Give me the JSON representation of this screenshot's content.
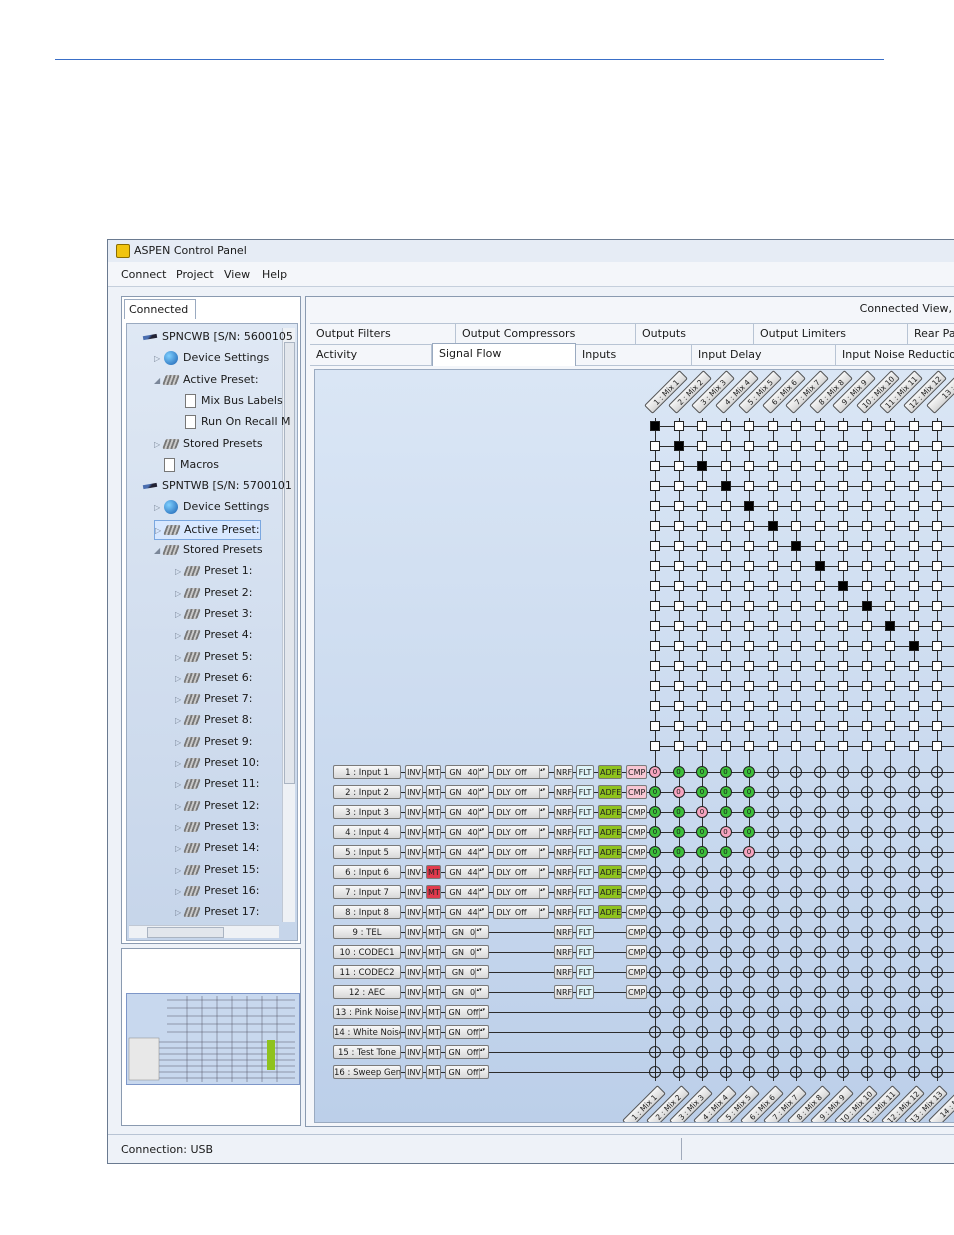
{
  "window": {
    "title": "ASPEN Control Panel"
  },
  "menu": [
    "Connect",
    "Project",
    "View",
    "Help"
  ],
  "left": {
    "tab": "Connected",
    "tree": [
      {
        "label": "SPNCWB [S/N: 5600105",
        "icon": "pen-icon",
        "level": 0,
        "arrow": ""
      },
      {
        "label": "Device Settings",
        "icon": "globe-icon",
        "level": 1,
        "arrow": "▷"
      },
      {
        "label": "Active Preset:",
        "icon": "chip-icon",
        "level": 1,
        "arrow": "◢"
      },
      {
        "label": "Mix Bus Labels",
        "icon": "document-icon",
        "level": 2,
        "arrow": ""
      },
      {
        "label": "Run On Recall M",
        "icon": "document-icon",
        "level": 2,
        "arrow": ""
      },
      {
        "label": "Stored Presets",
        "icon": "chip-icon",
        "level": 1,
        "arrow": "▷"
      },
      {
        "label": "Macros",
        "icon": "document-icon",
        "level": 1,
        "arrow": ""
      },
      {
        "label": "SPNTWB [S/N: 5700101",
        "icon": "pen-icon",
        "level": 0,
        "arrow": ""
      },
      {
        "label": "Device Settings",
        "icon": "globe-icon",
        "level": 1,
        "arrow": "▷"
      },
      {
        "label": "Active Preset:",
        "icon": "chip-icon",
        "level": 1,
        "arrow": "▷",
        "selected": true
      },
      {
        "label": "Stored Presets",
        "icon": "chip-icon",
        "level": 1,
        "arrow": "◢"
      },
      {
        "label": "Preset 1:",
        "icon": "chip-icon",
        "level": 2,
        "arrow": "▷"
      },
      {
        "label": "Preset 2:",
        "icon": "chip-icon",
        "level": 2,
        "arrow": "▷"
      },
      {
        "label": "Preset 3:",
        "icon": "chip-icon",
        "level": 2,
        "arrow": "▷"
      },
      {
        "label": "Preset 4:",
        "icon": "chip-icon",
        "level": 2,
        "arrow": "▷"
      },
      {
        "label": "Preset 5:",
        "icon": "chip-icon",
        "level": 2,
        "arrow": "▷"
      },
      {
        "label": "Preset 6:",
        "icon": "chip-icon",
        "level": 2,
        "arrow": "▷"
      },
      {
        "label": "Preset 7:",
        "icon": "chip-icon",
        "level": 2,
        "arrow": "▷"
      },
      {
        "label": "Preset 8:",
        "icon": "chip-icon",
        "level": 2,
        "arrow": "▷"
      },
      {
        "label": "Preset 9:",
        "icon": "chip-icon",
        "level": 2,
        "arrow": "▷"
      },
      {
        "label": "Preset 10:",
        "icon": "chip-icon",
        "level": 2,
        "arrow": "▷"
      },
      {
        "label": "Preset 11:",
        "icon": "chip-icon",
        "level": 2,
        "arrow": "▷"
      },
      {
        "label": "Preset 12:",
        "icon": "chip-icon",
        "level": 2,
        "arrow": "▷"
      },
      {
        "label": "Preset 13:",
        "icon": "chip-icon",
        "level": 2,
        "arrow": "▷"
      },
      {
        "label": "Preset 14:",
        "icon": "chip-icon",
        "level": 2,
        "arrow": "▷"
      },
      {
        "label": "Preset 15:",
        "icon": "chip-icon",
        "level": 2,
        "arrow": "▷"
      },
      {
        "label": "Preset 16:",
        "icon": "chip-icon",
        "level": 2,
        "arrow": "▷"
      },
      {
        "label": "Preset 17:",
        "icon": "chip-icon",
        "level": 2,
        "arrow": "▷"
      }
    ]
  },
  "right": {
    "header": "Connected View,",
    "tabs_row1": [
      "Output Filters",
      "Output Compressors",
      "Outputs",
      "Output Limiters",
      "Rear Pa"
    ],
    "tabs_row2": [
      "Activity",
      "Signal Flow",
      "Inputs",
      "Input Delay",
      "Input Noise Reduction"
    ],
    "active_tab": "Signal Flow"
  },
  "signal_flow": {
    "mix_labels_top": [
      "1 : Mix 1",
      "2 : Mix 2",
      "3 : Mix 3",
      "4 : Mix 4",
      "5 : Mix 5",
      "6 : Mix 6",
      "7 : Mix 7",
      "8 : Mix 8",
      "9 : Mix 9",
      "10 : Mix 10",
      "11 : Mix 11",
      "12 : Mix 12",
      "13 :"
    ],
    "mix_labels_bottom": [
      "1 : Mix 1",
      "2 : Mix 2",
      "3 : Mix 3",
      "4 : Mix 4",
      "5 : Mix 5",
      "6 : Mix 6",
      "7 : Mix 7",
      "8 : Mix 8",
      "9 : Mix 9",
      "10 : Mix 10",
      "11 : Mix 11",
      "12 : Mix 12",
      "13 : Mix 13",
      "14 : Mi"
    ],
    "inputs": [
      {
        "name": "1 : Input 1",
        "gain": "40",
        "delay": "Off",
        "mute": false,
        "adfe": true,
        "cmp": "pink",
        "nodes": "P0G0G0G0G0"
      },
      {
        "name": "2 : Input 2",
        "gain": "40",
        "delay": "Off",
        "mute": false,
        "adfe": true,
        "cmp": "pink",
        "nodes": "G0P0G0G0G0"
      },
      {
        "name": "3 : Input 3",
        "gain": "40",
        "delay": "Off",
        "mute": false,
        "adfe": true,
        "cmp": "",
        "nodes": "G0G0P0G0G0"
      },
      {
        "name": "4 : Input 4",
        "gain": "40",
        "delay": "Off",
        "mute": false,
        "adfe": true,
        "cmp": "",
        "nodes": "G0G0G0P0G0"
      },
      {
        "name": "5 : Input 5",
        "gain": "44",
        "delay": "Off",
        "mute": false,
        "adfe": true,
        "cmp": "",
        "nodes": "G0G0G0G0P0"
      },
      {
        "name": "6 : Input 6",
        "gain": "44",
        "delay": "Off",
        "mute": true,
        "adfe": true,
        "cmp": "",
        "nodes": ""
      },
      {
        "name": "7 : Input 7",
        "gain": "44",
        "delay": "Off",
        "mute": true,
        "adfe": true,
        "cmp": "",
        "nodes": ""
      },
      {
        "name": "8 : Input 8",
        "gain": "44",
        "delay": "Off",
        "mute": false,
        "adfe": true,
        "cmp": "",
        "nodes": ""
      },
      {
        "name": "9 : TEL",
        "gain": "0",
        "delay": "",
        "mute": false,
        "adfe": false,
        "cmp": "",
        "nodes": ""
      },
      {
        "name": "10 : CODEC1",
        "gain": "0",
        "delay": "",
        "mute": false,
        "adfe": false,
        "cmp": "",
        "nodes": ""
      },
      {
        "name": "11 : CODEC2",
        "gain": "0",
        "delay": "",
        "mute": false,
        "adfe": false,
        "cmp": "",
        "nodes": ""
      },
      {
        "name": "12 : AEC",
        "gain": "0",
        "delay": "",
        "mute": false,
        "adfe": false,
        "cmp": "",
        "nodes": ""
      },
      {
        "name": "13 : Pink Noise",
        "gain": "Off",
        "delay": "",
        "mute": false,
        "adfe": false,
        "cmp": "none",
        "nodes": ""
      },
      {
        "name": "14 : White Noise",
        "gain": "Off",
        "delay": "",
        "mute": false,
        "adfe": false,
        "cmp": "none",
        "nodes": ""
      },
      {
        "name": "15 : Test Tone",
        "gain": "Off",
        "delay": "",
        "mute": false,
        "adfe": false,
        "cmp": "none",
        "nodes": ""
      },
      {
        "name": "16 : Sweep Gen",
        "gain": "Off",
        "delay": "",
        "mute": false,
        "adfe": false,
        "cmp": "none",
        "nodes": ""
      }
    ],
    "btn": {
      "inv": "INV",
      "mt": "MT",
      "gn": "GN",
      "dly": "DLY",
      "nrf": "NRF",
      "flt": "FLT",
      "adfe": "ADFE",
      "cmp": "CMP",
      "node_value": "0"
    },
    "colors": {
      "mute_on": "#e03a4c",
      "adfe": "#8fc21e",
      "node_green": "#3cbf3a",
      "node_pink": "#f6a4c0"
    }
  },
  "status": {
    "text": "Connection: USB"
  }
}
